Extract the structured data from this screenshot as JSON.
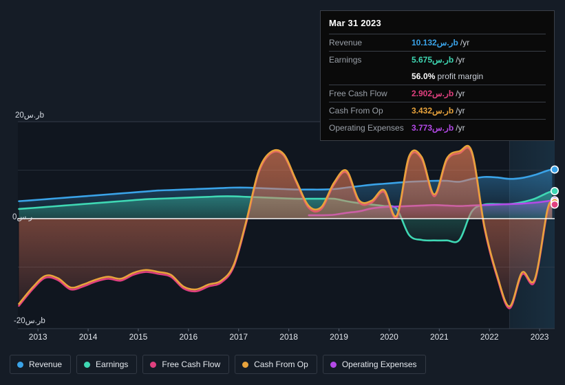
{
  "theme": {
    "background": "#151c26",
    "plot_background": "#10161f",
    "gridline": "#3a4250",
    "zero_line": "#ffffff",
    "axis_text": "#e2e6ec"
  },
  "tooltip": {
    "date": "Mar 31 2023",
    "rows": [
      {
        "label": "Revenue",
        "value": "10.132ر.سb",
        "unit": "/yr",
        "color": "#3aa3e8"
      },
      {
        "label": "Earnings",
        "value": "5.675ر.سb",
        "unit": "/yr",
        "color": "#3fd8b4"
      },
      {
        "label": "",
        "value": "56.0%",
        "unit": "profit margin",
        "color": "#ffffff"
      },
      {
        "label": "Free Cash Flow",
        "value": "2.902ر.سb",
        "unit": "/yr",
        "color": "#e0407f"
      },
      {
        "label": "Cash From Op",
        "value": "3.432ر.سb",
        "unit": "/yr",
        "color": "#e8a33c"
      },
      {
        "label": "Operating Expenses",
        "value": "3.773ر.سb",
        "unit": "/yr",
        "color": "#b44ae8"
      }
    ]
  },
  "legend": {
    "items": [
      {
        "label": "Revenue",
        "color": "#3aa3e8"
      },
      {
        "label": "Earnings",
        "color": "#3fd8b4"
      },
      {
        "label": "Free Cash Flow",
        "color": "#e0407f"
      },
      {
        "label": "Cash From Op",
        "color": "#e8a33c"
      },
      {
        "label": "Operating Expenses",
        "color": "#b44ae8"
      }
    ]
  },
  "chart_data": {
    "type": "line",
    "title": "",
    "xlabel": "",
    "ylabel": "",
    "currency": "ر.س",
    "unit": "b",
    "grid": true,
    "legend_position": "bottom",
    "ylim": [
      -20,
      20
    ],
    "ytick_labels": [
      "20ر.سb",
      "0ر.س",
      "-20ر.سb"
    ],
    "ytick_values": [
      20,
      0,
      -20
    ],
    "xlim": [
      2012.6,
      2023.3
    ],
    "xtick_labels": [
      "2013",
      "2014",
      "2015",
      "2016",
      "2017",
      "2018",
      "2019",
      "2020",
      "2021",
      "2022",
      "2023"
    ],
    "xtick_values": [
      2013,
      2014,
      2015,
      2016,
      2017,
      2018,
      2019,
      2020,
      2021,
      2022,
      2023
    ],
    "forecast_boundary": 2022.4,
    "x": [
      2012.62,
      2012.9,
      2013.15,
      2013.4,
      2013.65,
      2013.9,
      2014.15,
      2014.4,
      2014.65,
      2014.9,
      2015.15,
      2015.4,
      2015.65,
      2015.9,
      2016.15,
      2016.4,
      2016.65,
      2016.9,
      2017.15,
      2017.4,
      2017.65,
      2017.9,
      2018.15,
      2018.4,
      2018.65,
      2018.9,
      2019.15,
      2019.4,
      2019.65,
      2019.9,
      2020.15,
      2020.4,
      2020.65,
      2020.9,
      2021.15,
      2021.4,
      2021.65,
      2021.9,
      2022.15,
      2022.4,
      2022.65,
      2022.9,
      2023.15,
      2023.25
    ],
    "series": [
      {
        "name": "Revenue",
        "color": "#3aa3e8",
        "values": [
          3.6,
          3.8,
          4.0,
          4.2,
          4.4,
          4.6,
          4.8,
          5.0,
          5.2,
          5.4,
          5.6,
          5.8,
          5.9,
          6.0,
          6.1,
          6.2,
          6.3,
          6.4,
          6.4,
          6.3,
          6.2,
          6.1,
          6.0,
          6.0,
          6.0,
          6.1,
          6.4,
          6.7,
          7.0,
          7.2,
          7.4,
          7.6,
          7.7,
          7.8,
          7.8,
          7.6,
          8.2,
          8.6,
          8.5,
          8.2,
          8.4,
          9.0,
          9.9,
          10.132
        ]
      },
      {
        "name": "Earnings",
        "color": "#3fd8b4",
        "values": [
          2.0,
          2.2,
          2.4,
          2.6,
          2.8,
          3.0,
          3.2,
          3.4,
          3.6,
          3.8,
          4.0,
          4.1,
          4.2,
          4.3,
          4.4,
          4.5,
          4.6,
          4.6,
          4.5,
          4.4,
          4.3,
          4.2,
          4.1,
          4.1,
          4.1,
          4.1,
          3.6,
          3.2,
          2.9,
          2.6,
          2.0,
          -3.4,
          -4.4,
          -4.5,
          -4.5,
          -4.4,
          1.5,
          2.9,
          3.0,
          3.0,
          3.4,
          4.1,
          5.3,
          5.675
        ]
      },
      {
        "name": "Free Cash Flow",
        "color": "#e0407f",
        "values": [
          -18.0,
          -14.5,
          -12.2,
          -12.7,
          -14.6,
          -14.0,
          -13.0,
          -12.4,
          -12.8,
          -11.6,
          -11.0,
          -11.4,
          -12.0,
          -14.4,
          -15.0,
          -14.0,
          -13.2,
          -10.0,
          -1.0,
          9.5,
          13.5,
          13.0,
          7.5,
          2.2,
          2.0,
          7.0,
          9.5,
          3.4,
          3.3,
          5.5,
          0.2,
          12.5,
          12.3,
          4.6,
          12.0,
          13.5,
          13.4,
          -2.0,
          -12.0,
          -18.5,
          -11.5,
          -13.0,
          1.2,
          2.902
        ]
      },
      {
        "name": "Cash From Op",
        "color": "#e8a33c",
        "values": [
          -17.6,
          -14.1,
          -11.8,
          -12.3,
          -14.2,
          -13.6,
          -12.6,
          -12.0,
          -12.4,
          -11.2,
          -10.6,
          -11.0,
          -11.6,
          -14.0,
          -14.6,
          -13.6,
          -12.8,
          -9.6,
          -0.6,
          9.9,
          13.8,
          13.3,
          7.8,
          2.6,
          2.4,
          7.4,
          9.9,
          3.8,
          3.7,
          5.9,
          0.6,
          12.9,
          12.7,
          5.0,
          12.4,
          13.9,
          13.8,
          -1.6,
          -11.6,
          -18.1,
          -11.1,
          -12.6,
          1.6,
          3.432
        ]
      },
      {
        "name": "Operating Expenses",
        "color": "#b44ae8",
        "values": [
          null,
          null,
          null,
          null,
          null,
          null,
          null,
          null,
          null,
          null,
          null,
          null,
          null,
          null,
          null,
          null,
          null,
          null,
          null,
          null,
          null,
          null,
          null,
          0.7,
          0.7,
          0.8,
          1.2,
          1.5,
          2.1,
          2.4,
          2.5,
          2.6,
          2.7,
          2.8,
          2.7,
          2.6,
          2.7,
          2.8,
          2.9,
          3.0,
          3.1,
          3.3,
          3.6,
          3.773
        ]
      }
    ],
    "endpoint_markers": [
      {
        "series": "Revenue",
        "value": 10.132,
        "color": "#3aa3e8"
      },
      {
        "series": "Earnings",
        "value": 5.675,
        "color": "#3fd8b4"
      },
      {
        "series": "Operating Expenses",
        "value": 3.773,
        "color": "#b44ae8"
      },
      {
        "series": "Cash From Op",
        "value": 3.432,
        "color": "#e8a33c"
      },
      {
        "series": "Free Cash Flow",
        "value": 2.902,
        "color": "#e0407f"
      }
    ]
  }
}
